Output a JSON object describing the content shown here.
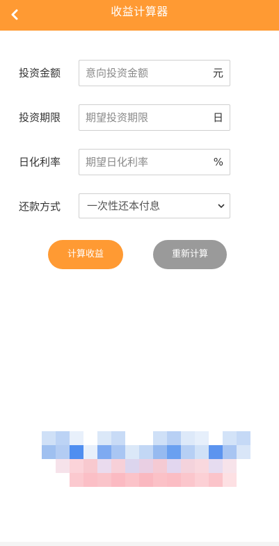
{
  "header": {
    "title": "收益计算器",
    "back_icon": "chevron-left-icon",
    "background_color": "#ff9a33"
  },
  "form": {
    "amount": {
      "label": "投资金额",
      "placeholder": "意向投资金额",
      "unit": "元"
    },
    "period": {
      "label": "投资期限",
      "placeholder": "期望投资期限",
      "unit": "日"
    },
    "rate": {
      "label": "日化利率",
      "placeholder": "期望日化利率",
      "unit": "%"
    },
    "repayment": {
      "label": "还款方式",
      "selected": "一次性还本付息",
      "options": [
        "一次性还本付息"
      ]
    }
  },
  "buttons": {
    "calculate": {
      "label": "计算收益",
      "color": "#ff9a33"
    },
    "reset": {
      "label": "重新计算",
      "color": "#9a9a9a"
    }
  }
}
